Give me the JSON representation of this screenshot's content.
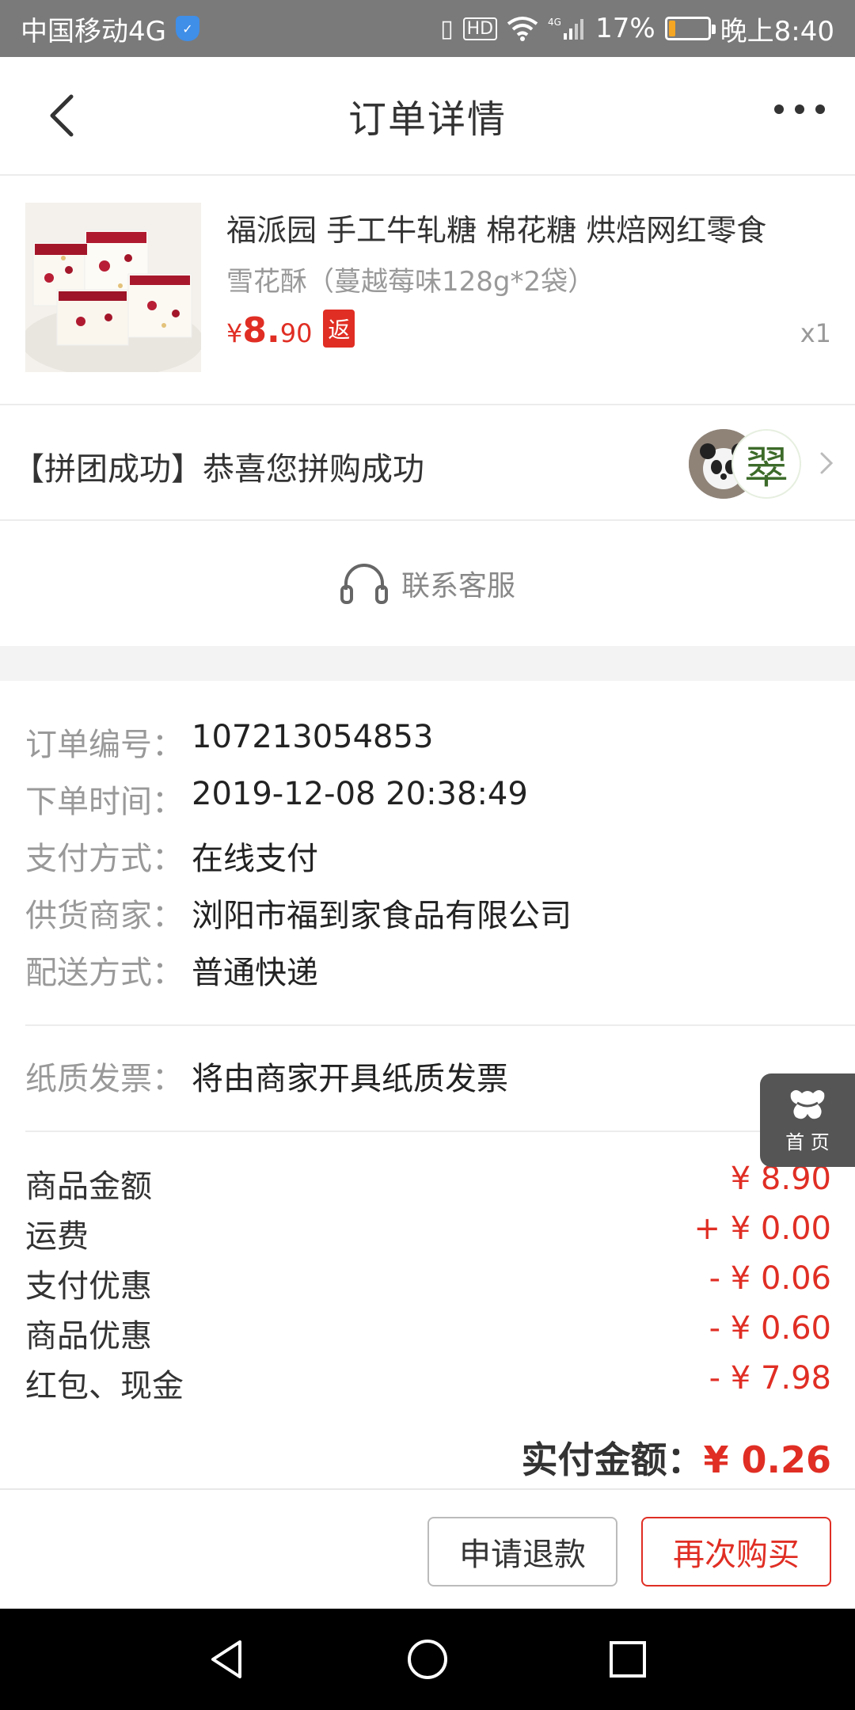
{
  "status_bar": {
    "carrier": "中国移动4G",
    "network": "4G",
    "battery_percent": "17%",
    "battery_level": 0.17,
    "time": "晚上8:40",
    "icons": [
      "shield-icon",
      "vibrate-icon",
      "hd-icon",
      "wifi-icon",
      "signal-icon",
      "battery-icon"
    ]
  },
  "nav": {
    "title": "订单详情"
  },
  "product": {
    "title": "福派园 手工牛轧糖 棉花糖 烘焙网红零食",
    "spec": "雪花酥（蔓越莓味128g*2袋）",
    "price_symbol": "¥",
    "price_int": "8.",
    "price_dec": "90",
    "badge": "返",
    "quantity": "x1"
  },
  "group": {
    "text": "【拼团成功】恭喜您拼购成功",
    "avatar2_char": "翠"
  },
  "service": {
    "label": "联系客服"
  },
  "order_info": [
    {
      "label": "订单编号：",
      "value": "107213054853"
    },
    {
      "label": "下单时间：",
      "value": "2019-12-08 20:38:49"
    },
    {
      "label": "支付方式：",
      "value": "在线支付"
    },
    {
      "label": "供货商家：",
      "value": "浏阳市福到家食品有限公司"
    },
    {
      "label": "配送方式：",
      "value": "普通快递"
    }
  ],
  "invoice": {
    "label": "纸质发票：",
    "value": "将由商家开具纸质发票"
  },
  "amounts": [
    {
      "label": "商品金额",
      "value": "¥ 8.90"
    },
    {
      "label": "运费",
      "value": "+ ¥ 0.00"
    },
    {
      "label": "支付优惠",
      "value": "- ¥ 0.06"
    },
    {
      "label": "商品优惠",
      "value": "- ¥ 0.60"
    },
    {
      "label": "红包、现金",
      "value": "- ¥ 7.98"
    }
  ],
  "total": {
    "label": "实付金额：",
    "value": "¥ 0.26"
  },
  "home_float": {
    "label": "首 页"
  },
  "buttons": {
    "refund": "申请退款",
    "rebuy": "再次购买"
  },
  "colors": {
    "accent": "#e02e24",
    "status_bar": "#7a7a7a",
    "battery": "#f5a623"
  }
}
